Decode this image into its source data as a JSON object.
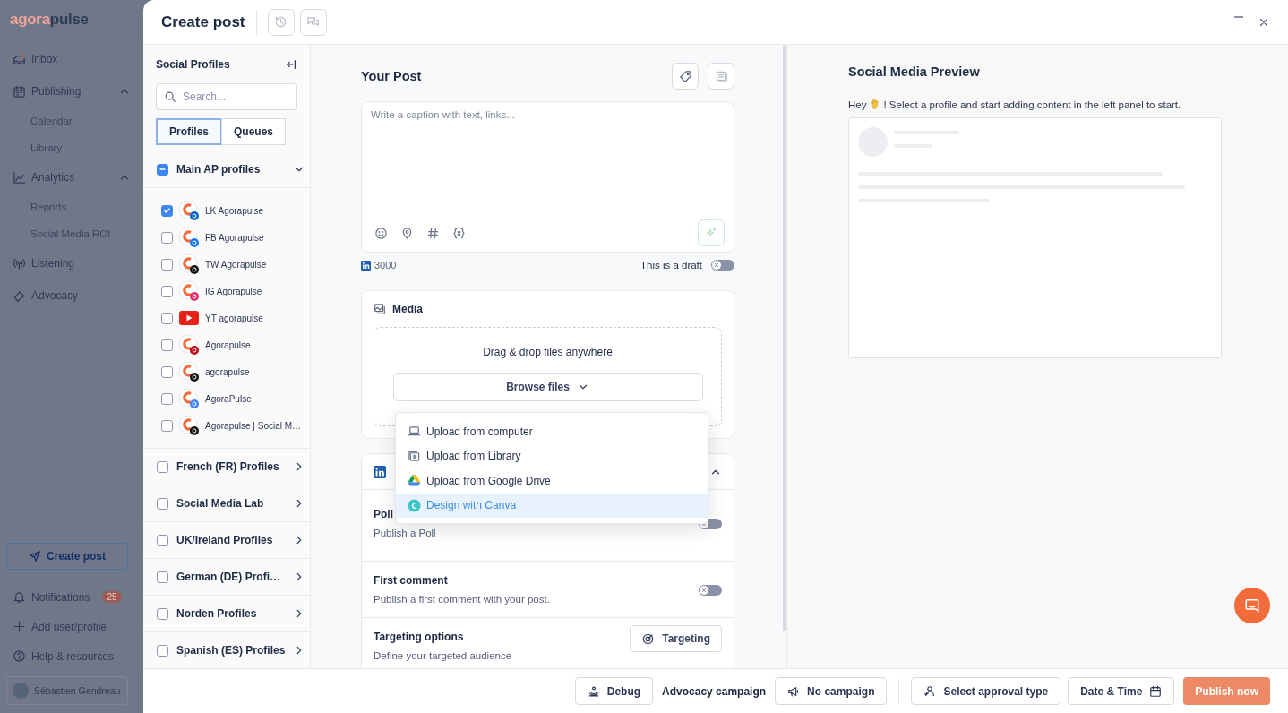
{
  "sidebar": {
    "logo": [
      "agora",
      "pulse"
    ],
    "items": [
      {
        "label": "Inbox"
      },
      {
        "label": "Publishing",
        "expanded": true,
        "children": [
          {
            "label": "Calendar"
          },
          {
            "label": "Library"
          }
        ]
      },
      {
        "label": "Analytics",
        "expanded": true,
        "children": [
          {
            "label": "Reports"
          },
          {
            "label": "Social Media ROI"
          }
        ]
      },
      {
        "label": "Listening"
      },
      {
        "label": "Advocacy"
      }
    ],
    "create_button": "Create post",
    "bottom_items": [
      {
        "label": "Notifications",
        "badge": "25"
      },
      {
        "label": "Add user/profile"
      },
      {
        "label": "Help & resources"
      }
    ],
    "user": {
      "name": "Sébastien Gendreau"
    }
  },
  "modal": {
    "title": "Create post"
  },
  "profiles": {
    "title": "Social Profiles",
    "search_placeholder": "Search...",
    "tabs": [
      {
        "label": "Profiles",
        "selected": true
      },
      {
        "label": "Queues",
        "selected": false
      }
    ],
    "groups": [
      {
        "label": "Main AP profiles",
        "indeterminate": true,
        "expanded": true,
        "children": [
          {
            "label": "LK Agorapulse",
            "kind": "linkedin",
            "checked": true
          },
          {
            "label": "FB Agorapulse",
            "kind": "facebook",
            "checked": false
          },
          {
            "label": "TW Agorapulse",
            "kind": "x",
            "checked": false
          },
          {
            "label": "IG Agorapulse",
            "kind": "instagram",
            "checked": false
          },
          {
            "label": "YT agorapulse",
            "kind": "youtube",
            "checked": false
          },
          {
            "label": "Agorapulse",
            "kind": "pinterest",
            "checked": false
          },
          {
            "label": "agorapulse",
            "kind": "tiktok",
            "checked": false
          },
          {
            "label": "AgoraPulse",
            "kind": "google",
            "checked": false
          },
          {
            "label": "Agorapulse | Social M…",
            "kind": "threads",
            "checked": false
          }
        ]
      },
      {
        "label": "French (FR) Profiles",
        "indeterminate": false,
        "expanded": false
      },
      {
        "label": "Social Media Lab",
        "indeterminate": false,
        "expanded": false
      },
      {
        "label": "UK/Ireland Profiles",
        "indeterminate": false,
        "expanded": false
      },
      {
        "label": "German (DE) Profi…",
        "indeterminate": false,
        "expanded": false
      },
      {
        "label": "Norden Profiles",
        "indeterminate": false,
        "expanded": false
      },
      {
        "label": "Spanish (ES) Profiles",
        "indeterminate": false,
        "expanded": false
      }
    ]
  },
  "post": {
    "title": "Your Post",
    "caption_placeholder": "Write a caption with text, links...",
    "char_count": "3000",
    "draft_label": "This is a draft",
    "draft_on": false,
    "media": {
      "title": "Media",
      "drop_text": "Drag & drop files anywhere",
      "browse_label": "Browse files",
      "menu": [
        {
          "label": "Upload from computer",
          "selected": false
        },
        {
          "label": "Upload from Library",
          "selected": false
        },
        {
          "label": "Upload from Google Drive",
          "selected": false
        },
        {
          "label": "Design with Canva",
          "selected": true
        }
      ]
    },
    "network_section": {
      "expanded": true,
      "options": [
        {
          "kind": "toggle",
          "title": "Poll",
          "description": "Publish a Poll",
          "on": false
        },
        {
          "kind": "toggle",
          "title": "First comment",
          "description": "Publish a first comment with your post.",
          "on": false
        },
        {
          "kind": "button",
          "title": "Targeting options",
          "description": "Define your targeted audience",
          "button": "Targeting"
        }
      ]
    }
  },
  "preview": {
    "title": "Social Media Preview",
    "greeting": "Hey",
    "message": "! Select a profile and start adding content in the left panel to start."
  },
  "footer": {
    "debug": "Debug",
    "advocacy_label": "Advocacy campaign",
    "campaign": "No campaign",
    "approval": "Select approval type",
    "datetime": "Date & Time",
    "publish": {
      "label": "Publish now",
      "disabled": true
    }
  }
}
